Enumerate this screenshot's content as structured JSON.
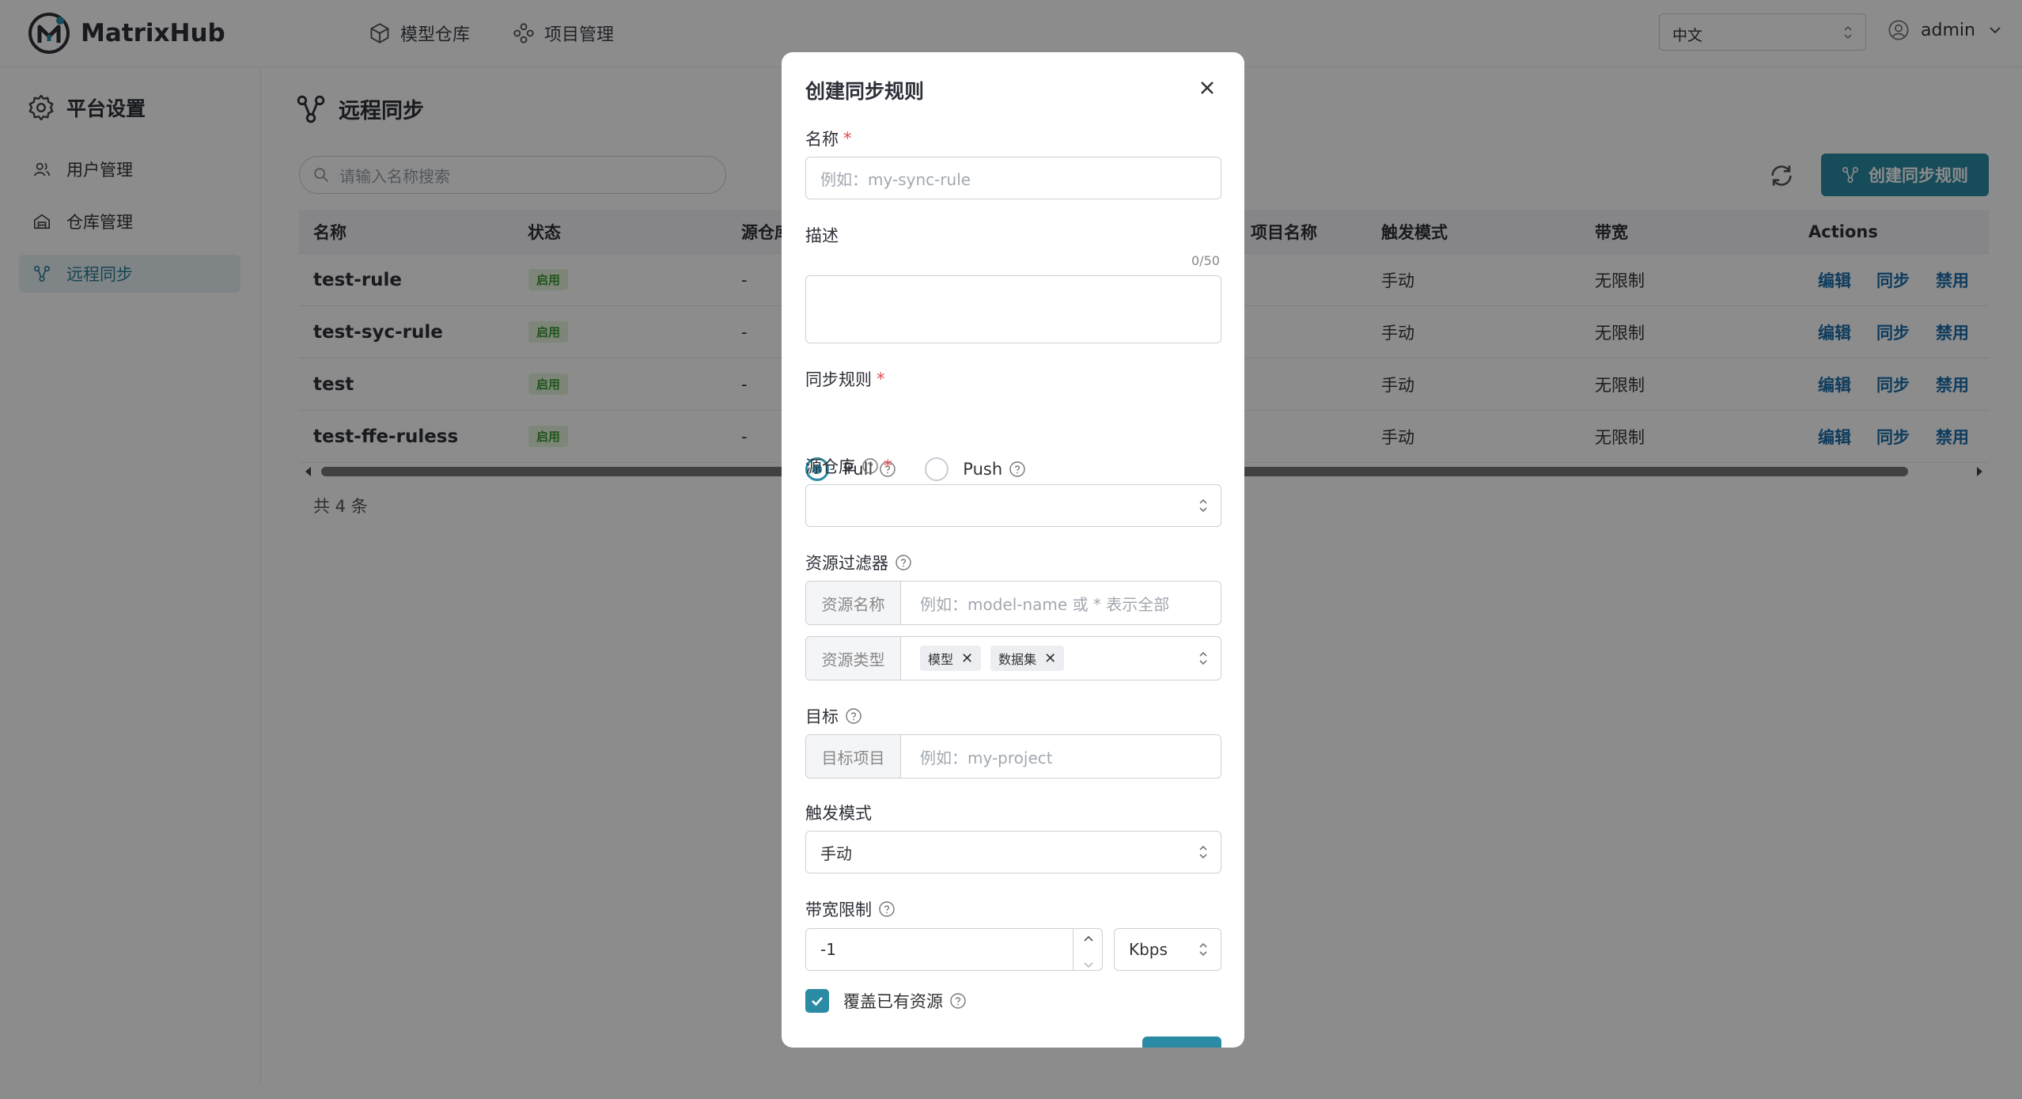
{
  "app": {
    "name": "MatrixHub"
  },
  "top_nav": [
    {
      "label": "模型仓库",
      "icon": "cube-icon"
    },
    {
      "label": "项目管理",
      "icon": "project-icon"
    }
  ],
  "language": {
    "selected": "中文"
  },
  "user": {
    "name": "admin"
  },
  "sidebar": {
    "title": "平台设置",
    "items": [
      {
        "label": "用户管理",
        "icon": "user-icon"
      },
      {
        "label": "仓库管理",
        "icon": "warehouse-icon"
      },
      {
        "label": "远程同步",
        "icon": "sync-icon",
        "active": true
      }
    ]
  },
  "main": {
    "title": "远程同步",
    "search_placeholder": "请输入名称搜索",
    "create_button": "创建同步规则",
    "columns": [
      "名称",
      "状态",
      "源仓库",
      "项目名称",
      "触发模式",
      "带宽",
      "Actions"
    ],
    "rows": [
      {
        "name": "test-rule",
        "status": "启用",
        "source": "-",
        "trigger": "手动",
        "bandwidth": "无限制"
      },
      {
        "name": "test-syc-rule",
        "status": "启用",
        "source": "-",
        "trigger": "手动",
        "bandwidth": "无限制"
      },
      {
        "name": "test",
        "status": "启用",
        "source": "-",
        "trigger": "手动",
        "bandwidth": "无限制"
      },
      {
        "name": "test-ffe-ruless",
        "status": "启用",
        "source": "-",
        "trigger": "手动",
        "bandwidth": "无限制"
      }
    ],
    "actions": {
      "edit": "编辑",
      "sync": "同步",
      "disable": "禁用"
    },
    "total": "共 4 条"
  },
  "modal": {
    "title": "创建同步规则",
    "name_label": "名称",
    "name_placeholder": "例如：my-sync-rule",
    "desc_label": "描述",
    "desc_counter": "0/50",
    "rule_label": "同步规则",
    "rule_options": [
      "Pull",
      "Push"
    ],
    "rule_selected": "Pull",
    "source_label": "源仓库",
    "filter_label": "资源过滤器",
    "filter_name_prefix": "资源名称",
    "filter_name_placeholder": "例如：model-name 或 * 表示全部",
    "filter_type_prefix": "资源类型",
    "filter_type_tags": [
      "模型",
      "数据集"
    ],
    "target_label": "目标",
    "target_prefix": "目标项目",
    "target_placeholder": "例如：my-project",
    "trigger_label": "触发模式",
    "trigger_value": "手动",
    "bandwidth_label": "带宽限制",
    "bandwidth_value": "-1",
    "bandwidth_unit": "Kbps",
    "overwrite_label": "覆盖已有资源",
    "overwrite_checked": true
  },
  "colors": {
    "primary": "#2b8ba5",
    "link": "#1c6dab",
    "badge_bg": "#e3f5dd",
    "badge_text": "#3c9a34"
  }
}
